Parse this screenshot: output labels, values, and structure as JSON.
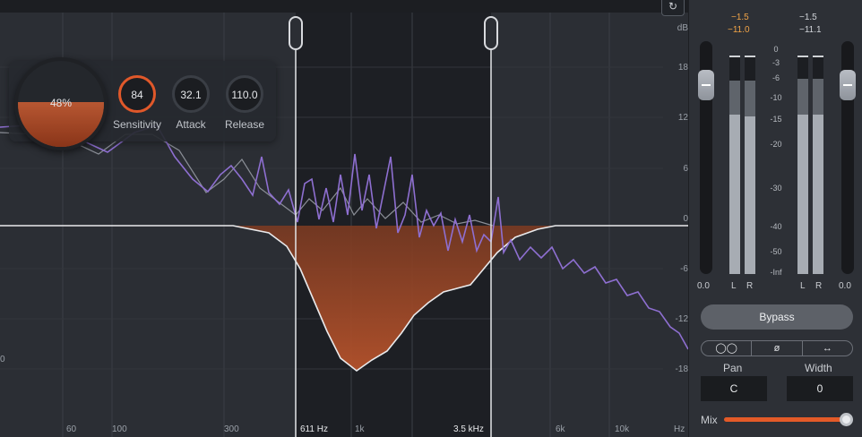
{
  "analyzer": {
    "freq_labels": [
      "60",
      "100",
      "300",
      "1k",
      "6k",
      "10k",
      "Hz"
    ],
    "db_labels": [
      "dB",
      "18",
      "12",
      "6",
      "0",
      "-6",
      "-12",
      "-18"
    ],
    "left_edge_label": "0",
    "band_low_label": "611 Hz",
    "band_high_label": "3.5 kHz",
    "topbar_icon": "loop-icon"
  },
  "module": {
    "amount": "48%",
    "sensitivity_value": "84",
    "sensitivity_label": "Sensitivity",
    "attack_value": "32.1",
    "attack_label": "Attack",
    "release_value": "110.0",
    "release_label": "Release",
    "accent_color": "#e0582a"
  },
  "side": {
    "input_peak_l": "−1.5",
    "input_peak_r": "−11.0",
    "output_peak_l": "−1.5",
    "output_peak_r": "−11.1",
    "scale": [
      "0",
      "-3",
      "-6",
      "-10",
      "-15",
      "-20",
      "-30",
      "-40",
      "-50",
      "-Inf"
    ],
    "input_gain": "0.0",
    "output_gain": "0.0",
    "ch_l": "L",
    "ch_r": "R",
    "bypass_label": "Bypass",
    "seg_mono": "◯◯",
    "seg_phase": "ø",
    "seg_swap": "↔",
    "pan_label": "Pan",
    "pan_value": "C",
    "width_label": "Width",
    "width_value": "0",
    "mix_label": "Mix",
    "mix_level": 1.0
  }
}
